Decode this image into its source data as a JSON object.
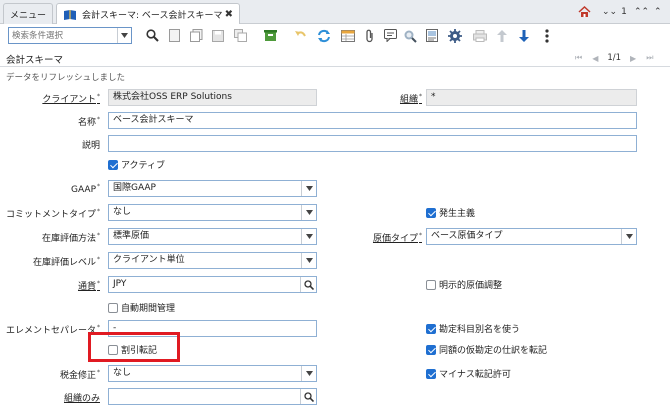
{
  "tabs": {
    "menu_label": "メニュー",
    "active_label": "会計スキーマ: ベース会計スキーマ",
    "close_glyph": "✖"
  },
  "topbar": {
    "notification_count": "1"
  },
  "toolbar": {
    "search_placeholder": "検索条件選択"
  },
  "section": {
    "title": "会計スキーマ",
    "pager_text": "1/1"
  },
  "status_message": "データをリフレッシュしました",
  "form": {
    "client": {
      "label": "クライアント",
      "value": "株式会社OSS ERP Solutions"
    },
    "org": {
      "label": "組織",
      "value": "*"
    },
    "name": {
      "label": "名称",
      "value": "ベース会計スキーマ"
    },
    "description": {
      "label": "説明",
      "value": ""
    },
    "active": {
      "label": "アクティブ",
      "checked": true
    },
    "gaap": {
      "label": "GAAP",
      "value": "国際GAAP"
    },
    "commitment_type": {
      "label": "コミットメントタイプ",
      "value": "なし"
    },
    "accrual": {
      "label": "発生主義",
      "checked": true
    },
    "costing_method": {
      "label": "在庫評価方法",
      "value": "標準原価"
    },
    "cost_type": {
      "label": "原価タイプ",
      "value": "ベース原価タイプ"
    },
    "costing_level": {
      "label": "在庫評価レベル",
      "value": "クライアント単位"
    },
    "currency": {
      "label": "通貨",
      "value": "JPY"
    },
    "explicit_cost_adjustment": {
      "label": "明示的原価調整",
      "checked": false
    },
    "auto_period_control": {
      "label": "自動期間管理",
      "checked": false
    },
    "element_separator": {
      "label": "エレメントセパレータ",
      "value": "-"
    },
    "use_account_alias": {
      "label": "勘定科目別名を使う",
      "checked": true
    },
    "post_trade_discount": {
      "label": "割引転記",
      "checked": false
    },
    "post_suspense_balancing": {
      "label": "同額の仮勘定の仕訳を転記",
      "checked": true
    },
    "tax_correction": {
      "label": "税金修正",
      "value": "なし"
    },
    "post_negative": {
      "label": "マイナス転記許可",
      "checked": true
    },
    "org_only": {
      "label": "組織のみ",
      "value": ""
    }
  },
  "colors": {
    "accent": "#1f6fd1",
    "highlight": "#e01a22",
    "field_border": "#8fb0d4"
  },
  "icons": [
    "book-icon",
    "home-icon",
    "double-chevron-down-icon",
    "chevron-up-icon",
    "search-icon",
    "new-record-icon",
    "copy-icon",
    "save-icon",
    "refresh-icon",
    "grid-icon",
    "attachment-icon",
    "chat-icon",
    "zoom-across-icon",
    "report-icon",
    "process-gear-icon",
    "print-icon",
    "arrow-up-icon",
    "arrow-down-icon",
    "more-vertical-icon"
  ]
}
